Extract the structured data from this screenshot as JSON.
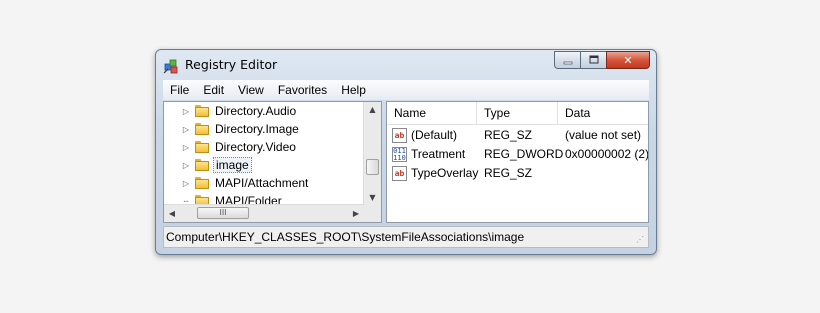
{
  "window": {
    "title": "Registry Editor",
    "close_glyph": "✕",
    "minimize_glyph": "—"
  },
  "menu": [
    "File",
    "Edit",
    "View",
    "Favorites",
    "Help"
  ],
  "tree": {
    "items": [
      {
        "label": "Directory.Audio",
        "selected": false
      },
      {
        "label": "Directory.Image",
        "selected": false
      },
      {
        "label": "Directory.Video",
        "selected": false
      },
      {
        "label": "image",
        "selected": true
      },
      {
        "label": "MAPI/Attachment",
        "selected": false
      },
      {
        "label": "MAPI/Folder",
        "selected": false
      }
    ],
    "hscroll_thumb_label": "III"
  },
  "values": {
    "columns": [
      "Name",
      "Type",
      "Data"
    ],
    "rows": [
      {
        "icon": "string-value-icon",
        "name": "(Default)",
        "type": "REG_SZ",
        "data": "(value not set)"
      },
      {
        "icon": "binary-value-icon",
        "name": "Treatment",
        "type": "REG_DWORD",
        "data": "0x00000002 (2)"
      },
      {
        "icon": "string-value-icon",
        "name": "TypeOverlay",
        "type": "REG_SZ",
        "data": ""
      }
    ]
  },
  "status": {
    "path": "Computer\\HKEY_CLASSES_ROOT\\SystemFileAssociations\\image"
  },
  "icons": {
    "string_value_glyph": "ab",
    "binary_value_glyph": "011\n110"
  },
  "colors": {
    "accent_close": "#d4553b",
    "folder": "#f0bf3c"
  }
}
